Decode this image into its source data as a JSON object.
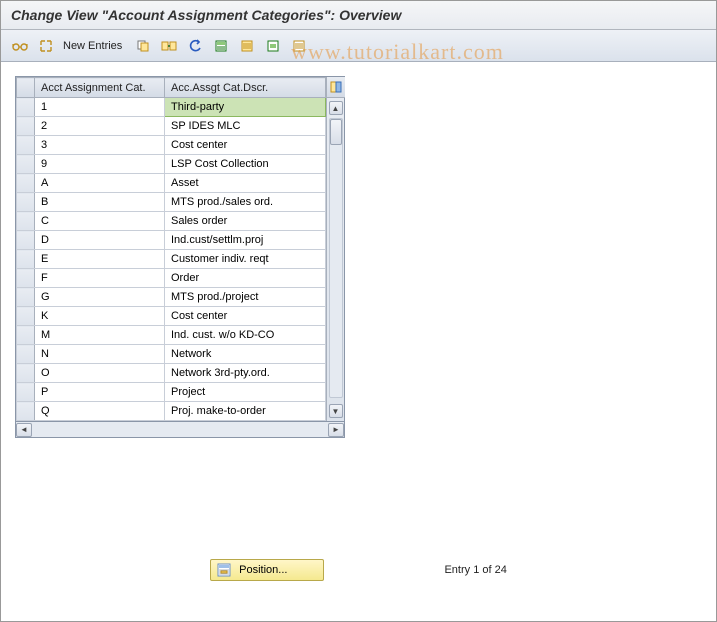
{
  "title": "Change View \"Account Assignment Categories\": Overview",
  "toolbar": {
    "new_entries": "New Entries"
  },
  "watermark": "www.tutorialkart.com",
  "table": {
    "headers": {
      "cat": "Acct Assignment Cat.",
      "desc": "Acc.Assgt Cat.Dscr."
    },
    "rows": [
      {
        "cat": "1",
        "desc": "Third-party"
      },
      {
        "cat": "2",
        "desc": "SP IDES MLC"
      },
      {
        "cat": "3",
        "desc": "Cost center"
      },
      {
        "cat": "9",
        "desc": "LSP Cost Collection"
      },
      {
        "cat": "A",
        "desc": "Asset"
      },
      {
        "cat": "B",
        "desc": "MTS prod./sales ord."
      },
      {
        "cat": "C",
        "desc": "Sales order"
      },
      {
        "cat": "D",
        "desc": "Ind.cust/settlm.proj"
      },
      {
        "cat": "E",
        "desc": "Customer indiv. reqt"
      },
      {
        "cat": "F",
        "desc": "Order"
      },
      {
        "cat": "G",
        "desc": "MTS prod./project"
      },
      {
        "cat": "K",
        "desc": "Cost center"
      },
      {
        "cat": "M",
        "desc": "Ind. cust. w/o KD-CO"
      },
      {
        "cat": "N",
        "desc": "Network"
      },
      {
        "cat": "O",
        "desc": "Network 3rd-pty.ord."
      },
      {
        "cat": "P",
        "desc": "Project"
      },
      {
        "cat": "Q",
        "desc": "Proj. make-to-order"
      }
    ]
  },
  "footer": {
    "position_label": "Position...",
    "entry_text": "Entry 1 of 24"
  }
}
